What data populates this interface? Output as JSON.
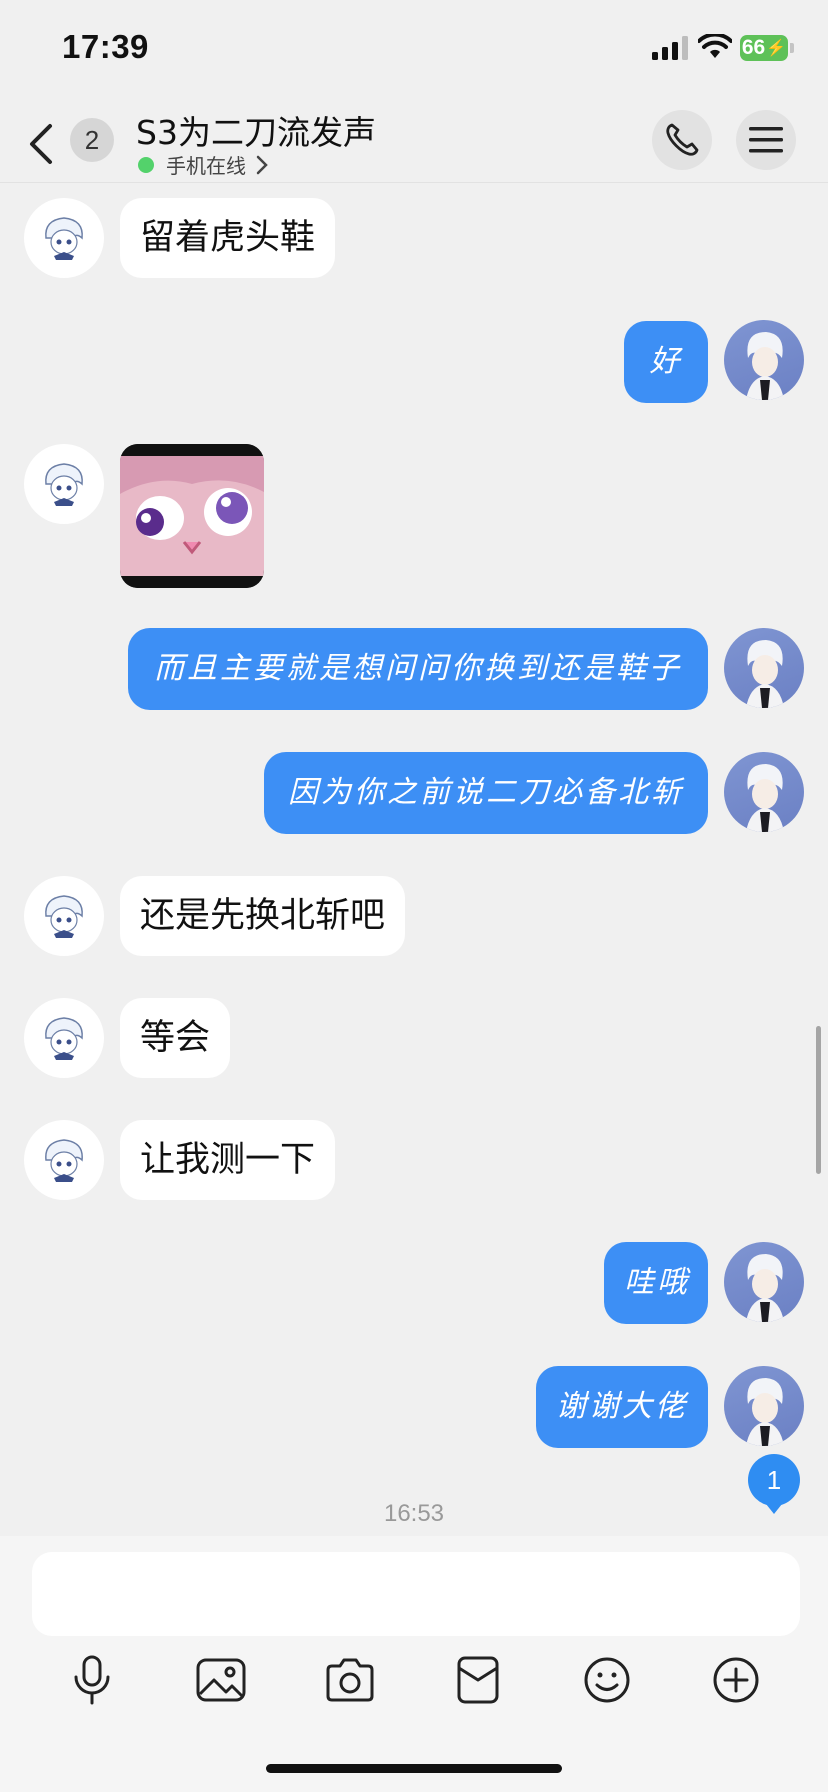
{
  "status": {
    "time": "17:39",
    "battery": "66"
  },
  "header": {
    "unread_count": "2",
    "title": "S3为二刀流发声",
    "subtitle": "手机在线"
  },
  "messages": [
    {
      "side": "in",
      "text": "留着虎头鞋"
    },
    {
      "side": "out",
      "text": "好"
    },
    {
      "side": "in",
      "type": "sticker"
    },
    {
      "side": "out",
      "text": "而且主要就是想问问你换到还是鞋子"
    },
    {
      "side": "out",
      "text": "因为你之前说二刀必备北斩"
    },
    {
      "side": "in",
      "text": "还是先换北斩吧"
    },
    {
      "side": "in",
      "text": "等会"
    },
    {
      "side": "in",
      "text": "让我测一下"
    },
    {
      "side": "out",
      "text": "哇哦"
    },
    {
      "side": "out",
      "text": "谢谢大佬"
    }
  ],
  "new_message_badge": "1",
  "timestamp": "16:53",
  "input": {
    "placeholder": ""
  },
  "toolbar": [
    "microphone-icon",
    "image-icon",
    "camera-icon",
    "red-packet-icon",
    "emoji-icon",
    "plus-icon"
  ],
  "colors": {
    "accent": "#3d8ff5",
    "online": "#53d26b",
    "battery": "#5ec158"
  }
}
